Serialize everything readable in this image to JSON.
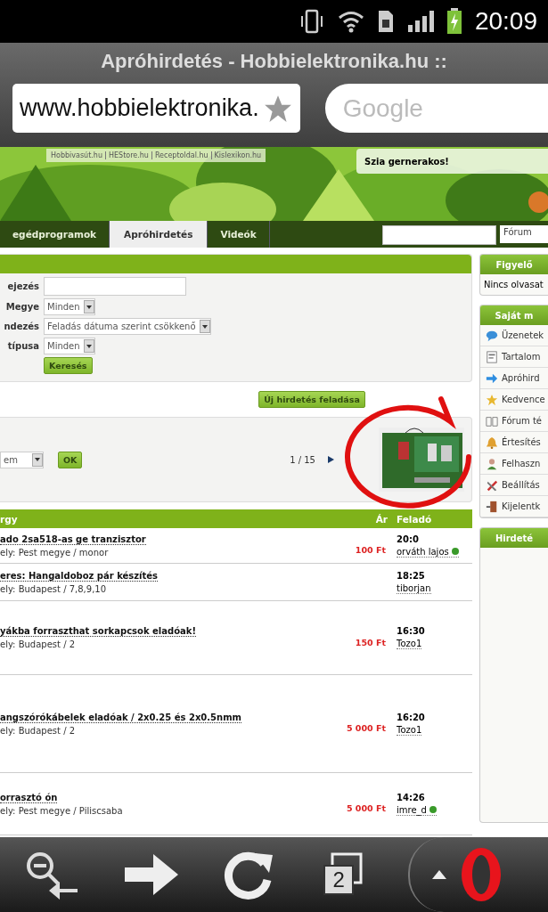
{
  "status_bar": {
    "time": "20:09"
  },
  "browser": {
    "title": "Apróhirdetés - Hobbielektronika.hu ::",
    "url": "www.hobbielektronika.",
    "search_placeholder": "Google"
  },
  "header": {
    "links": [
      "Hobbivasút.hu",
      "HEStore.hu",
      "Receptoldal.hu",
      "Kislexikon.hu"
    ],
    "greeting": "Szia gernerakos!"
  },
  "nav": {
    "tabs": [
      {
        "label": "egédprogramok",
        "selected": false
      },
      {
        "label": "Apróhirdetés",
        "selected": true
      },
      {
        "label": "Videók",
        "selected": false
      }
    ],
    "forum_select": "Fórum"
  },
  "search_form": {
    "fields": [
      {
        "label": "ejezés",
        "kind": "text"
      },
      {
        "label": "Megye",
        "kind": "select",
        "value": "Minden"
      },
      {
        "label": "ndezés",
        "kind": "select",
        "value": "Feladás dátuma szerint csökkenő"
      },
      {
        "label": "típusa",
        "kind": "select",
        "value": "Minden"
      }
    ],
    "submit": "Keresés"
  },
  "new_ad_button": "Új hirdetés feladása",
  "pager": {
    "select": "em",
    "ok": "OK",
    "page": "1 / 15"
  },
  "table": {
    "columns": [
      "rgy",
      "Ár",
      "Feladó"
    ],
    "rows": [
      {
        "title": "ado 2sa518-as ge tranzisztor",
        "location": "ely: Pest megye / monor",
        "price": "100 Ft",
        "time": "20:0",
        "user": "orváth lajos",
        "online": true
      },
      {
        "title": "eres: Hangaldoboz pár készítés",
        "location": "ely: Budapest / 7,8,9,10",
        "time": "18:25",
        "user": "tiborjan",
        "online": false
      },
      {
        "title": "yákba forraszthat sorkapcsok eladóak!",
        "location": "ely: Budapest / 2",
        "price": "150 Ft",
        "time": "16:30",
        "user": "Tozo1",
        "online": false
      },
      {
        "title": "angszórókábelek eladóak / 2x0.25 és 2x0.5nmm",
        "location": "ely: Budapest / 2",
        "price": "5 000 Ft",
        "time": "16:20",
        "user": "Tozo1",
        "online": false
      },
      {
        "title": "orrasztó ón",
        "location": "ely: Pest megye / Piliscsaba",
        "price": "5 000 Ft",
        "time": "14:26",
        "user": "imre_d",
        "online": true
      }
    ]
  },
  "sidebar": {
    "watch": {
      "title": "Figyelő",
      "text": "Nincs olvasat"
    },
    "mine": {
      "title": "Saját m",
      "items": [
        {
          "label": "Üzenetek",
          "kind": "chat"
        },
        {
          "label": "Tartalom",
          "kind": "doc"
        },
        {
          "label": "Apróhird",
          "kind": "arrow"
        },
        {
          "label": "Kedvence",
          "kind": "star"
        },
        {
          "label": "Fórum té",
          "kind": "book"
        },
        {
          "label": "Értesítés",
          "kind": "bell"
        },
        {
          "label": "Felhaszn",
          "kind": "user"
        },
        {
          "label": "Beállítás",
          "kind": "tools"
        },
        {
          "label": "Kijelentk",
          "kind": "door"
        }
      ]
    },
    "ads": {
      "title": "Hirdeté"
    }
  },
  "toolbar": {
    "tab_count": "2"
  }
}
